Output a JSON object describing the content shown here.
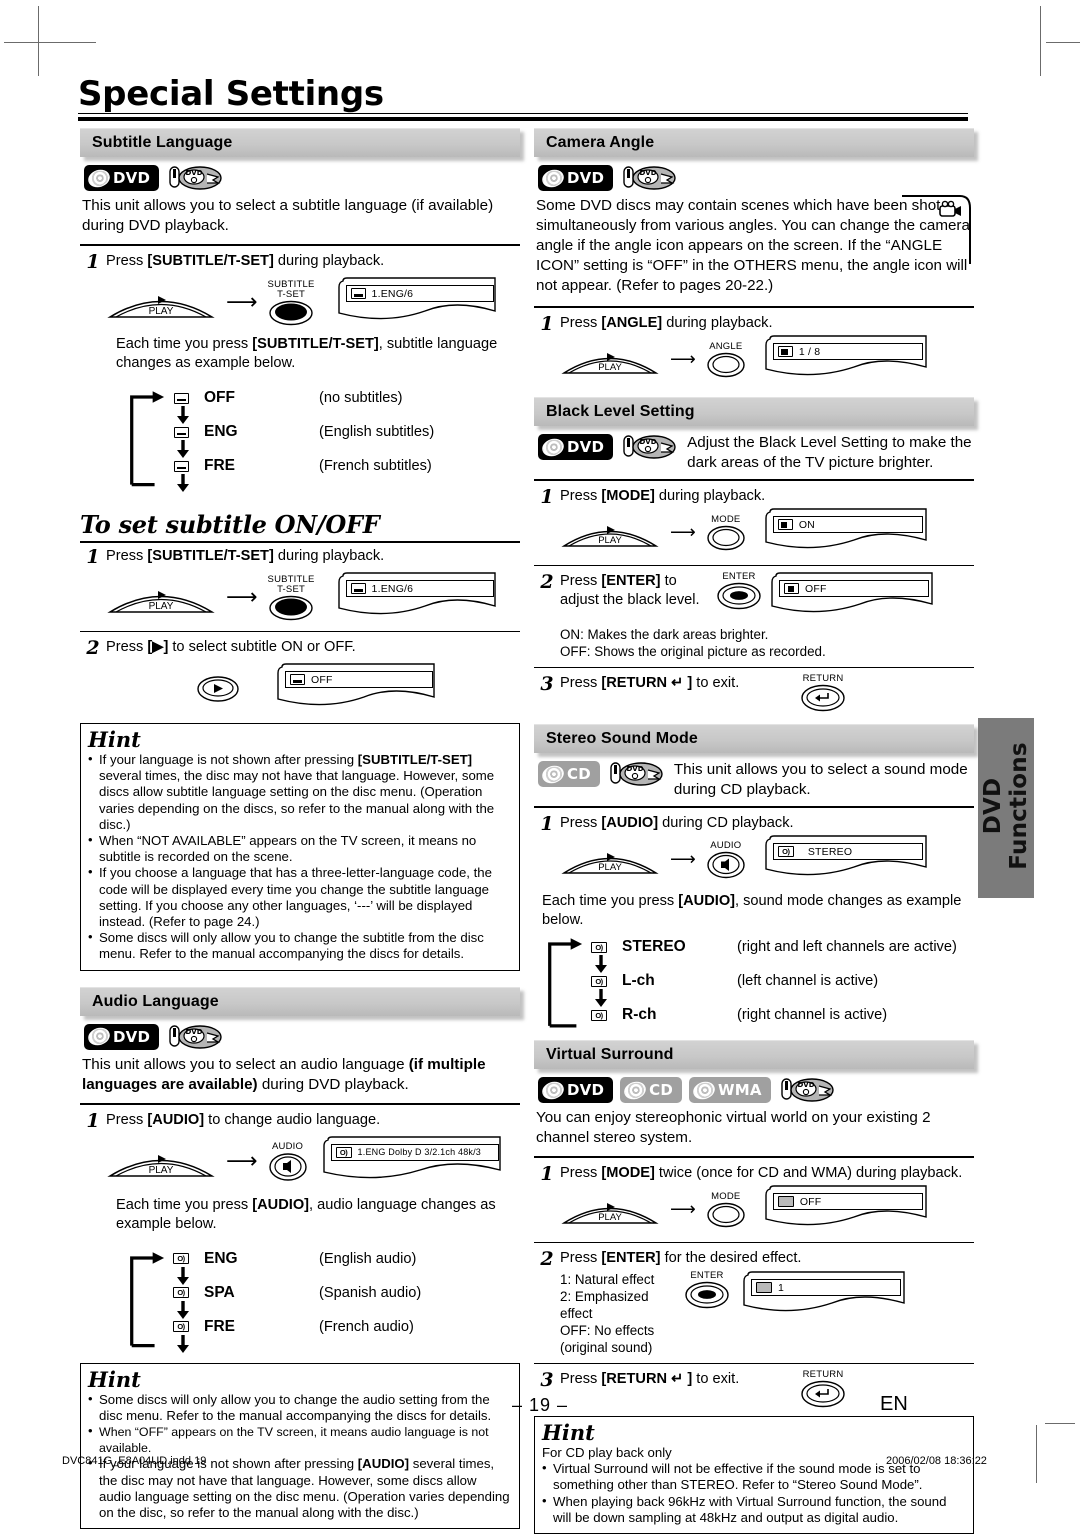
{
  "page": {
    "title": "Special Settings",
    "page_number": "– 19 –",
    "lang_mark": "EN",
    "side_tab": "DVD Functions",
    "footer_left": "DVC841G_E8A04UD.indd   19",
    "footer_right": "2006/02/08   18:36:22"
  },
  "icons": {
    "dvd_badge": "dvd-disc-badge",
    "cd_badge": "cd-disc-badge",
    "wma_badge": "wma-disc-badge",
    "dvd_player": "dvd-player-icon",
    "subtitle_osd": "subtitle-icon",
    "audio_osd": "audio-icon",
    "angle_osd": "angle-icon",
    "black_osd": "black-level-icon",
    "surround_osd": "virtual-surround-icon",
    "camera_angle": "camcorder-icon"
  },
  "sections": {
    "subtitle_language": {
      "heading": "Subtitle Language",
      "badges": [
        "DVD"
      ],
      "intro": "This unit allows you to select a subtitle language (if available) during DVD playback.",
      "step1": {
        "num": "1",
        "text_pre": "Press ",
        "text_key": "[SUBTITLE/T-SET]",
        "text_post": " during playback.",
        "key_label": "SUBTITLE\nT-SET",
        "key_label_line1": "SUBTITLE",
        "key_label_line2": "T-SET",
        "play_label": "PLAY",
        "osd_value": "1.ENG/6"
      },
      "note_pre": "Each time you press ",
      "note_key": "[SUBTITLE/T-SET]",
      "note_post": ", subtitle language changes as example below.",
      "cycle": [
        {
          "label": "OFF",
          "desc": "(no subtitles)"
        },
        {
          "label": "ENG",
          "desc": "(English subtitles)"
        },
        {
          "label": "FRE",
          "desc": "(French subtitles)"
        }
      ]
    },
    "subtitle_onoff": {
      "heading": "To set subtitle ON/OFF",
      "step1": {
        "num": "1",
        "text_pre": "Press ",
        "text_key": "[SUBTITLE/T-SET]",
        "text_post": " during playback.",
        "key_label_line1": "SUBTITLE",
        "key_label_line2": "T-SET",
        "play_label": "PLAY",
        "osd_value": "1.ENG/6"
      },
      "step2": {
        "num": "2",
        "text_pre": "Press ",
        "text_key": "[▶]",
        "text_post": " to select subtitle ON or OFF.",
        "osd_value": "OFF"
      }
    },
    "subtitle_hint": {
      "heading": "Hint",
      "bullets": [
        "If your language is not shown after pressing [SUBTITLE/T-SET] several times, the disc may not have that language. However, some discs allow subtitle language setting on the disc menu. (Operation varies depending on the discs, so refer to the manual along with the disc.)",
        "When “NOT AVAILABLE” appears on the TV screen, it means no subtitle is recorded on the scene.",
        "If you choose a language that has a three-letter-language code, the code will be displayed every time you change the subtitle language setting. If you choose any other languages, ‘---’ will be displayed instead. (Refer to page 24.)",
        "Some discs will only allow you to change the subtitle from the disc menu. Refer to the manual accompanying the discs for details."
      ]
    },
    "audio_language": {
      "heading": "Audio Language",
      "badges": [
        "DVD"
      ],
      "intro_pre": "This unit allows you to select an audio language ",
      "intro_bold": "(if multiple languages are available)",
      "intro_post": " during DVD playback.",
      "step1": {
        "num": "1",
        "text_pre": "Press ",
        "text_key": "[AUDIO]",
        "text_post": " to change audio language.",
        "key_label": "AUDIO",
        "play_label": "PLAY",
        "osd_value": "1.ENG  Dolby D  3/2.1ch  48k/3"
      },
      "note_pre": "Each time you press ",
      "note_key": "[AUDIO]",
      "note_post": ", audio language changes as example below.",
      "cycle": [
        {
          "label": "ENG",
          "desc": "(English audio)"
        },
        {
          "label": "SPA",
          "desc": "(Spanish audio)"
        },
        {
          "label": "FRE",
          "desc": "(French audio)"
        }
      ]
    },
    "audio_hint": {
      "heading": "Hint",
      "bullets": [
        "Some discs will only allow you to change the audio setting from the disc menu. Refer to the manual accompanying the discs for details.",
        "When “OFF” appears on the TV screen, it means audio language is not available.",
        "If your language is not shown after pressing [AUDIO] several times, the disc may not have that language. However, some discs allow audio language setting on the disc menu. (Operation varies depending on the disc, so refer to the manual along with the disc.)"
      ]
    },
    "camera_angle": {
      "heading": "Camera Angle",
      "badges": [
        "DVD"
      ],
      "intro": "Some DVD discs may contain scenes which have been shot simultaneously from various angles. You can change the camera angle if the angle icon appears on the screen. If the “ANGLE ICON” setting is “OFF” in the OTHERS menu, the angle icon will not appear. (Refer to pages 20-22.)",
      "step1": {
        "num": "1",
        "text_pre": "Press ",
        "text_key": "[ANGLE]",
        "text_post": " during playback.",
        "key_label": "ANGLE",
        "play_label": "PLAY",
        "osd_value": "1 / 8"
      }
    },
    "black_level": {
      "heading": "Black Level Setting",
      "badges": [
        "DVD"
      ],
      "intro": "Adjust the Black Level Setting to make the dark areas of the TV picture brighter.",
      "step1": {
        "num": "1",
        "text_pre": "Press ",
        "text_key": "[MODE]",
        "text_post": " during playback.",
        "key_label": "MODE",
        "play_label": "PLAY",
        "osd_value": "ON"
      },
      "step2": {
        "num": "2",
        "text_pre": "Press ",
        "text_key": "[ENTER]",
        "text_post": " to adjust the black level.",
        "key_label": "ENTER",
        "osd_value": "OFF",
        "note_on": "ON: Makes the dark areas brighter.",
        "note_off": "OFF: Shows the original picture as recorded."
      },
      "step3": {
        "num": "3",
        "text_pre": "Press ",
        "text_key": "[RETURN ↵ ]",
        "text_post": " to exit.",
        "key_label": "RETURN"
      }
    },
    "stereo_sound": {
      "heading": "Stereo Sound Mode",
      "badges": [
        "CD"
      ],
      "intro": "This unit allows you to select a sound mode during CD playback.",
      "step1": {
        "num": "1",
        "text_pre": "Press ",
        "text_key": "[AUDIO]",
        "text_post": " during CD playback.",
        "key_label": "AUDIO",
        "play_label": "PLAY",
        "osd_value": "STEREO"
      },
      "note_pre": "Each time you press ",
      "note_key": "[AUDIO]",
      "note_post": ", sound mode changes as example below.",
      "cycle": [
        {
          "label": "STEREO",
          "desc": "(right and left channels are active)"
        },
        {
          "label": "L-ch",
          "desc": "(left channel is active)"
        },
        {
          "label": "R-ch",
          "desc": "(right channel is active)"
        }
      ]
    },
    "virtual_surround": {
      "heading": "Virtual Surround",
      "badges": [
        "DVD",
        "CD",
        "WMA"
      ],
      "intro": "You can enjoy stereophonic virtual world on your existing 2 channel stereo system.",
      "step1": {
        "num": "1",
        "text_pre": "Press ",
        "text_key": "[MODE]",
        "text_post": " twice (once for CD and WMA) during playback.",
        "key_label": "MODE",
        "play_label": "PLAY",
        "osd_value": "OFF"
      },
      "step2": {
        "num": "2",
        "text_pre": "Press ",
        "text_key": "[ENTER]",
        "text_post": " for the desired effect.",
        "key_label": "ENTER",
        "osd_value": "1",
        "note1": "1: Natural effect",
        "note2": "2: Emphasized effect",
        "note3": "OFF: No effects (original sound)"
      },
      "step3": {
        "num": "3",
        "text_pre": "Press ",
        "text_key": "[RETURN ↵ ]",
        "text_post": " to exit.",
        "key_label": "RETURN"
      }
    },
    "surround_hint": {
      "heading": "Hint",
      "lead": "For CD play back only",
      "bullets": [
        "Virtual Surround will not be effective if the sound mode is set to something other than STEREO. Refer to “Stereo Sound Mode”.",
        "When playing back 96kHz with Virtual Surround function, the sound will be down sampling at 48kHz and output as digital audio."
      ]
    }
  }
}
